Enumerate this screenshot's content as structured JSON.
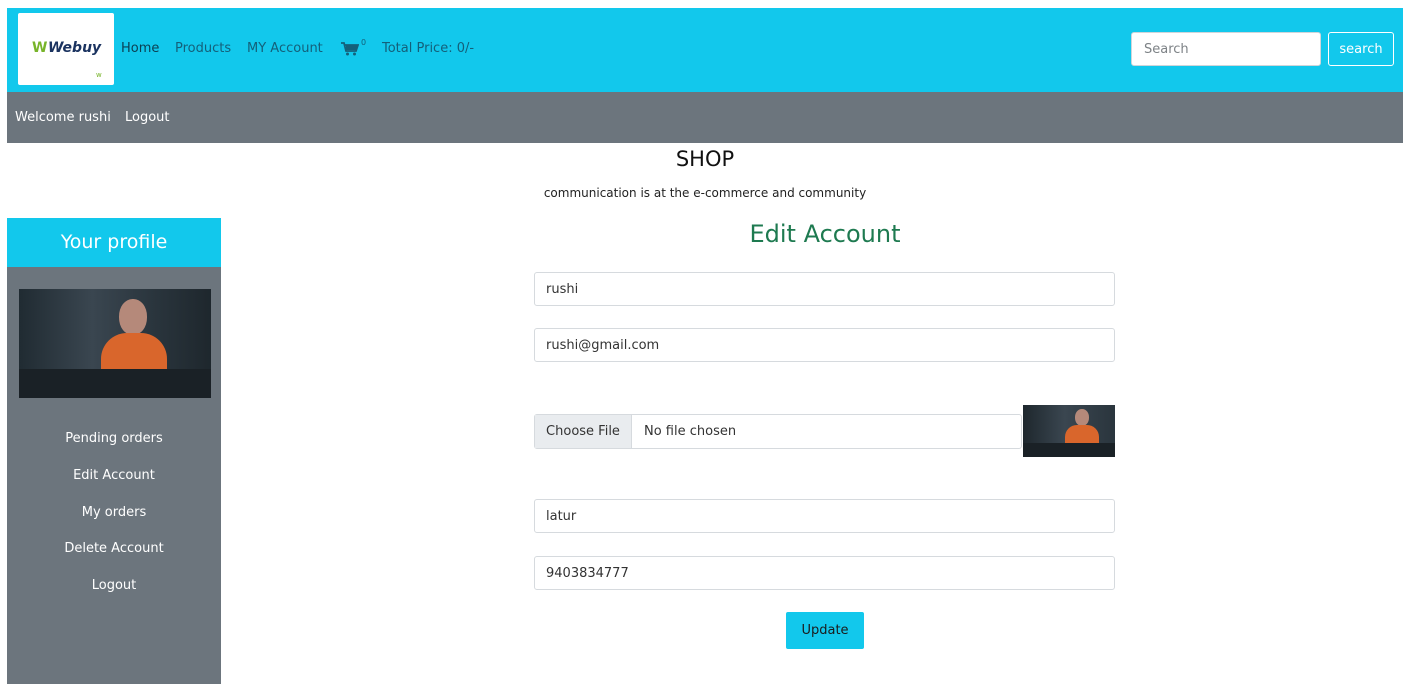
{
  "header": {
    "logo_text": "Webuy",
    "nav": {
      "home": "Home",
      "products": "Products",
      "account": "MY Account",
      "cart_count": "0",
      "total_price": "Total Price: 0/-"
    },
    "search": {
      "placeholder": "Search",
      "button": "search"
    },
    "accent_color": "#12c8ec"
  },
  "subbar": {
    "welcome": "Welcome rushi",
    "logout": "Logout",
    "color": "#6c757d"
  },
  "shop": {
    "title": "SHOP",
    "subtitle": "communication is at the e-commerce and community"
  },
  "sidebar": {
    "title": "Your profile",
    "items": [
      {
        "label": "Pending orders"
      },
      {
        "label": "Edit Account"
      },
      {
        "label": "My orders"
      },
      {
        "label": "Delete Account"
      },
      {
        "label": "Logout"
      }
    ]
  },
  "form": {
    "title": "Edit Account",
    "name": "rushi",
    "email": "rushi@gmail.com",
    "file": {
      "button": "Choose File",
      "status": "No file chosen"
    },
    "city": "latur",
    "phone": "9403834777",
    "submit": "Update"
  }
}
